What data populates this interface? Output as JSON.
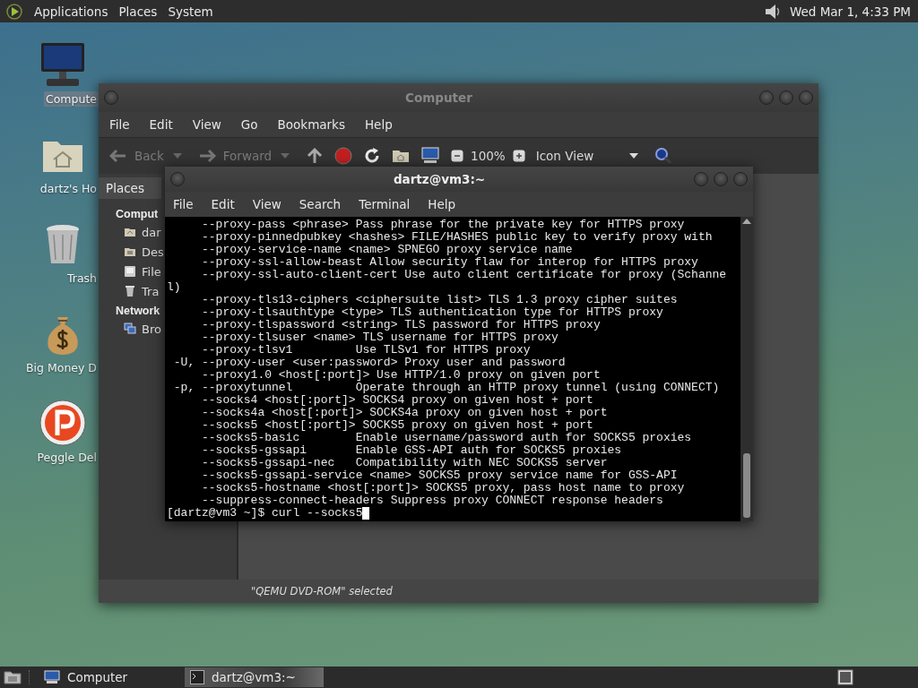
{
  "top_panel": {
    "menus": [
      "Applications",
      "Places",
      "System"
    ],
    "clock": "Wed Mar 1, 4:33 PM"
  },
  "desktop_icons": [
    {
      "label": "Compute",
      "kind": "computer",
      "selected": true
    },
    {
      "label": "dartz's Ho",
      "kind": "home",
      "selected": false
    },
    {
      "label": "Trash",
      "kind": "trash",
      "selected": false
    },
    {
      "label": "Big Money D",
      "kind": "money",
      "selected": false
    },
    {
      "label": "Peggle Del",
      "kind": "peggle",
      "selected": false
    }
  ],
  "file_manager": {
    "title": "Computer",
    "active": false,
    "menu": [
      "File",
      "Edit",
      "View",
      "Go",
      "Bookmarks",
      "Help"
    ],
    "toolbar": {
      "back": {
        "label": "Back",
        "disabled": true
      },
      "forward": {
        "label": "Forward",
        "disabled": true
      },
      "zoom": "100%",
      "view": "Icon View"
    },
    "sidebar": {
      "header": "Places",
      "sections": [
        {
          "title": "Comput",
          "items": [
            {
              "label": "dar",
              "kind": "home"
            },
            {
              "label": "Des",
              "kind": "desktop"
            },
            {
              "label": "File",
              "kind": "drive"
            },
            {
              "label": "Tra",
              "kind": "trash"
            }
          ]
        },
        {
          "title": "Network",
          "items": [
            {
              "label": "Bro",
              "kind": "network"
            }
          ]
        }
      ]
    },
    "status": "\"QEMU DVD-ROM\" selected"
  },
  "terminal": {
    "title": "dartz@vm3:~",
    "active": true,
    "menu": [
      "File",
      "Edit",
      "View",
      "Search",
      "Terminal",
      "Help"
    ],
    "lines": [
      "     --proxy-pass <phrase> Pass phrase for the private key for HTTPS proxy",
      "     --proxy-pinnedpubkey <hashes> FILE/HASHES public key to verify proxy with",
      "     --proxy-service-name <name> SPNEGO proxy service name",
      "     --proxy-ssl-allow-beast Allow security flaw for interop for HTTPS proxy",
      "     --proxy-ssl-auto-client-cert Use auto client certificate for proxy (Schanne",
      "l)",
      "     --proxy-tls13-ciphers <ciphersuite list> TLS 1.3 proxy cipher suites",
      "     --proxy-tlsauthtype <type> TLS authentication type for HTTPS proxy",
      "     --proxy-tlspassword <string> TLS password for HTTPS proxy",
      "     --proxy-tlsuser <name> TLS username for HTTPS proxy",
      "     --proxy-tlsv1         Use TLSv1 for HTTPS proxy",
      " -U, --proxy-user <user:password> Proxy user and password",
      "     --proxy1.0 <host[:port]> Use HTTP/1.0 proxy on given port",
      " -p, --proxytunnel         Operate through an HTTP proxy tunnel (using CONNECT)",
      "     --socks4 <host[:port]> SOCKS4 proxy on given host + port",
      "     --socks4a <host[:port]> SOCKS4a proxy on given host + port",
      "     --socks5 <host[:port]> SOCKS5 proxy on given host + port",
      "     --socks5-basic        Enable username/password auth for SOCKS5 proxies",
      "     --socks5-gssapi       Enable GSS-API auth for SOCKS5 proxies",
      "     --socks5-gssapi-nec   Compatibility with NEC SOCKS5 server",
      "     --socks5-gssapi-service <name> SOCKS5 proxy service name for GSS-API",
      "     --socks5-hostname <host[:port]> SOCKS5 proxy, pass host name to proxy",
      "     --suppress-connect-headers Suppress proxy CONNECT response headers"
    ],
    "prompt": "[dartz@vm3 ~]$ curl --socks5"
  },
  "taskbar": {
    "tasks": [
      {
        "label": "Computer",
        "kind": "file-manager",
        "selected": false
      },
      {
        "label": "dartz@vm3:~",
        "kind": "terminal",
        "selected": true
      }
    ]
  }
}
